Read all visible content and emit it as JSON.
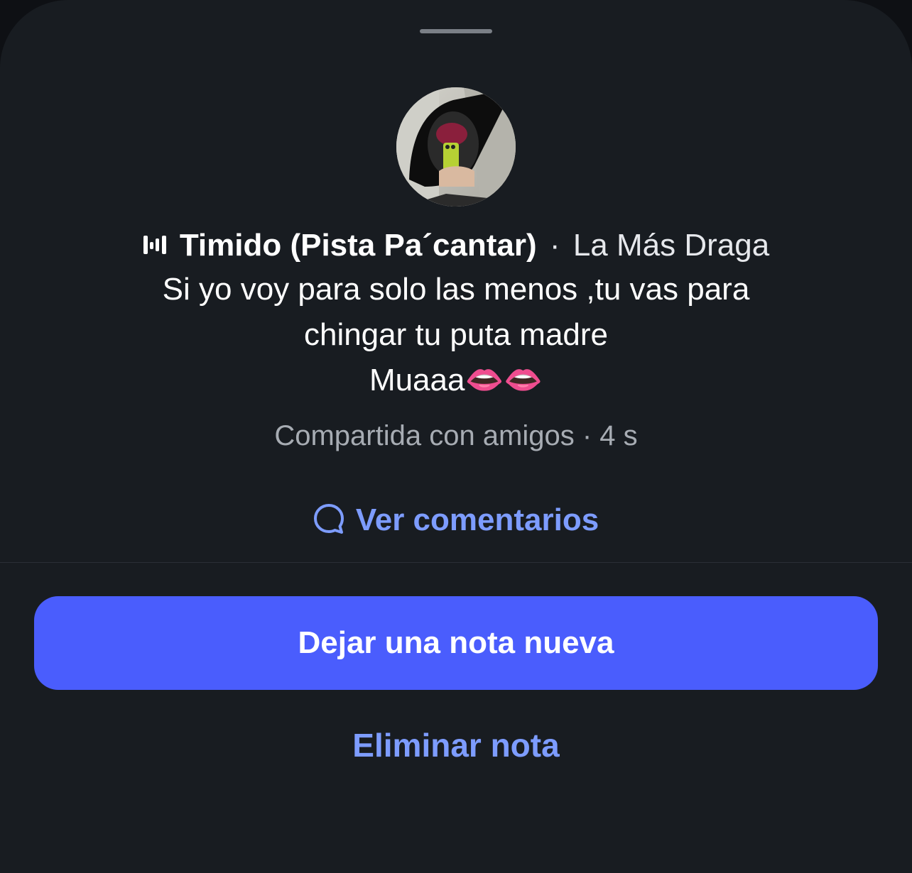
{
  "sheet": {
    "handle": "grabber"
  },
  "note": {
    "avatar_icon": "profile-photo",
    "music": {
      "icon": "equalizer-icon",
      "song": "Timido (Pista Pa´cantar)",
      "separator": "·",
      "artist": "La Más Draga"
    },
    "text_lines": [
      "Si yo voy para solo las menos ,tu vas para",
      "chingar tu puta madre",
      "Muaaa👄👄"
    ],
    "meta": "Compartida con amigos · 4 s"
  },
  "comments": {
    "icon": "speech-bubble-icon",
    "label": "Ver comentarios"
  },
  "actions": {
    "new_note_label": "Dejar una nota nueva",
    "delete_label": "Eliminar nota"
  },
  "colors": {
    "background": "#181c21",
    "accent_button": "#4a5dfd",
    "link": "#7d9cff",
    "secondary_text": "#a7acb3"
  }
}
